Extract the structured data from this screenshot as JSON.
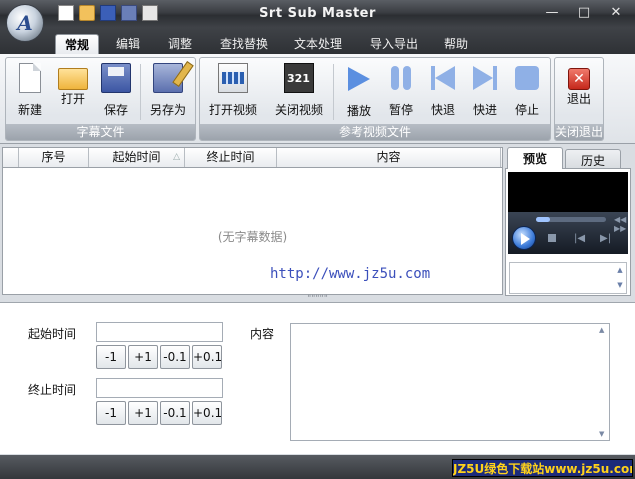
{
  "window": {
    "title": "Srt Sub Master",
    "min_glyph": "—",
    "max_glyph": "□",
    "close_glyph": "✕",
    "orb_glyph": "A"
  },
  "quick_access": [
    "new",
    "open",
    "save",
    "save-as",
    "extra"
  ],
  "tabs": [
    "常规",
    "编辑",
    "调整",
    "查找替换",
    "文本处理",
    "导入导出",
    "帮助"
  ],
  "ribbon": {
    "subtitle_file_group": "字幕文件",
    "video_group": "参考视频文件",
    "exit_group": "关闭退出",
    "buttons": {
      "new": "新建",
      "open": "打开",
      "save": "保存",
      "save_as": "另存为",
      "open_video": "打开视频",
      "close_video": "关闭视频",
      "play": "播放",
      "pause": "暂停",
      "rewind": "快退",
      "forward": "快进",
      "stop": "停止",
      "exit": "退出"
    },
    "exit_glyph": "✕"
  },
  "table": {
    "columns": [
      "序号",
      "起始时间",
      "终止时间",
      "内容"
    ],
    "sort_glyph": "△",
    "empty_text": "(无字幕数据)"
  },
  "watermark": "http://www.jz5u.com",
  "preview": {
    "tab_preview": "预览",
    "tab_history": "历史",
    "seek_fraction": 0.2,
    "prev_glyph": "|◀",
    "next_glyph": "▶|",
    "vol_glyph": "◀◀ ▶▶",
    "scroll_up": "▲",
    "scroll_down": "▼"
  },
  "splitter_grip": "\"\"\"\"\"",
  "editor": {
    "start_label": "起始时间",
    "end_label": "终止时间",
    "content_label": "内容",
    "start_value": "",
    "end_value": "",
    "steps": [
      "-1",
      "+1",
      "-0.1",
      "+0.1"
    ],
    "scroll_up": "▲",
    "scroll_down": "▼"
  },
  "status": {
    "badge": "JZ5U绿色下载站www.jz5u.com"
  },
  "colors": {
    "accent": "#5b8fe0",
    "exit_red": "#c5281b",
    "badge_bg": "#1c2b7a",
    "badge_fg": "#ffd21a",
    "watermark": "#3b4fbb"
  }
}
